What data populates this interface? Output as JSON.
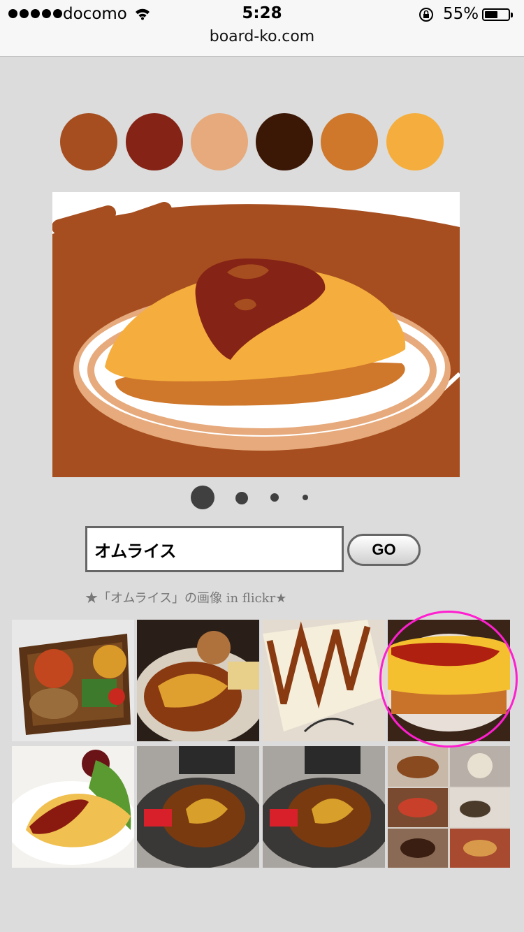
{
  "status_bar": {
    "carrier": "docomo",
    "time": "5:28",
    "battery_percent": "55%",
    "battery_level": 0.55
  },
  "browser": {
    "url": "board-ko.com"
  },
  "palette": {
    "colors": [
      "#a64e1f",
      "#852316",
      "#e6aa7c",
      "#3b1806",
      "#cf772a",
      "#f5ae3d"
    ]
  },
  "pagination": {
    "count": 4,
    "active_index": 0
  },
  "search": {
    "value": "オムライス",
    "go_label": "GO"
  },
  "results_caption": "★「オムライス」の画像 in flickr★",
  "thumbnails": [
    "bento-box-photo",
    "omurice-demi-glace-photo",
    "omurice-sauce-zigzag-photo",
    "omurice-ketchup-photo",
    "omelette-salad-photo",
    "omurice-iron-plate-photo",
    "omurice-iron-plate-photo",
    "course-meal-collage-photo"
  ],
  "highlighted_thumbnail_index": 3
}
